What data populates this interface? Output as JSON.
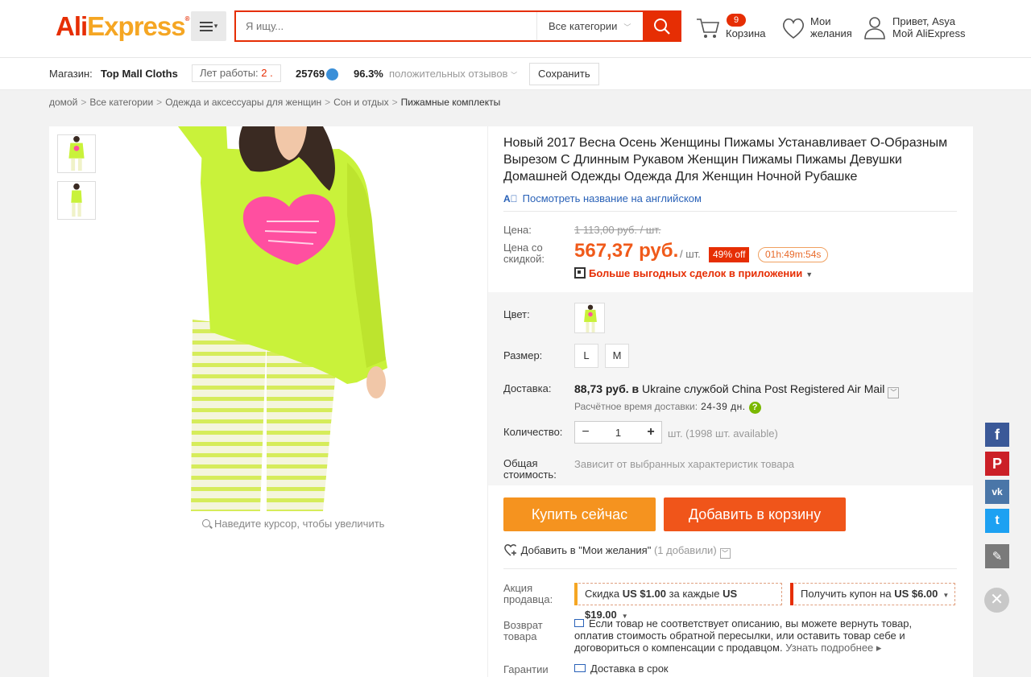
{
  "header": {
    "logo_part1": "Ali",
    "logo_part2": "Express",
    "logo_tm": "®",
    "search_placeholder": "Я ищу...",
    "category": "Все категории",
    "cart_count": "9",
    "cart_label": "Корзина",
    "wishlist_line1": "Мои",
    "wishlist_line2": "желания",
    "account_line1": "Привет, Asya",
    "account_line2": "Мой AliExpress"
  },
  "store": {
    "label": "Магазин:",
    "name": "Top Mall Cloths",
    "years_label": "Лет работы:",
    "years_value": "2 .",
    "score": "25769",
    "positive_pct": "96.3%",
    "positive_label": "положительных отзывов",
    "save_label": "Сохранить"
  },
  "breadcrumb": {
    "items": [
      "домой",
      "Все категории",
      "Одежда и аксессуары для женщин",
      "Сон и отдых"
    ],
    "current": "Пижамные комплекты",
    "separator": ">"
  },
  "gallery": {
    "zoom_hint": "Наведите курсор, чтобы увеличить"
  },
  "product": {
    "title": "Новый 2017 Весна Осень Женщины Пижамы Устанавливает О-Образным Вырезом С Длинным Рукавом Женщин Пижамы Пижамы Девушки Домашней Одежды Одежда Для Женщин Ночной Рубашке",
    "english_link": "Посмотреть название на английском",
    "price_label": "Цена:",
    "old_price": "1 113,00 руб. / шт.",
    "discount_label_1": "Цена со",
    "discount_label_2": "скидкой:",
    "new_price": "567,37 руб.",
    "unit": "/ шт.",
    "discount_badge": "49% off",
    "timer": "01h:49m:54s",
    "app_deal": "Больше выгодных сделок в приложении"
  },
  "options": {
    "color_label": "Цвет:",
    "size_label": "Размер:",
    "sizes": [
      "L",
      "M"
    ],
    "shipping_label": "Доставка:",
    "shipping_price": "88,73 руб.",
    "shipping_in": "в",
    "shipping_text": "Ukraine службой China Post Registered Air Mail",
    "eta_label": "Расчётное время доставки:",
    "eta_value": "24-39 дн.",
    "quantity_label": "Количество:",
    "quantity_value": "1",
    "quantity_minus": "−",
    "quantity_plus": "+",
    "quantity_info": "шт. (1998 шт. available)",
    "total_label_1": "Общая",
    "total_label_2": "стоимость:",
    "total_text": "Зависит от выбранных характеристик товара"
  },
  "actions": {
    "buy_now": "Купить сейчас",
    "add_to_cart": "Добавить в корзину",
    "add_wishlist": "Добавить в \"Мои желания\"",
    "wishlist_count": "(1 добавили)"
  },
  "promo": {
    "label_1": "Акция",
    "label_2": "продавца:",
    "discount_1": "Скидка",
    "discount_amount": "US $1.00",
    "discount_2": "за каждые",
    "discount_threshold": "US $19.00",
    "coupon_text": "Получить купон на",
    "coupon_amount": "US $6.00"
  },
  "returns": {
    "label_1": "Возврат",
    "label_2": "товара",
    "text": "Если товар не соответствует описанию, вы можете вернуть товар, оплатив стоимость обратной пересылки, или оставить товар себе и договориться о компенсации с продавцом.",
    "more": "Узнать подробнее"
  },
  "guarantee": {
    "label": "Гарантии",
    "text": "Доставка в срок"
  },
  "colors": {
    "accent": "#e62e04",
    "price": "#f05a1a",
    "buy": "#f5931f",
    "cart": "#f0551a",
    "link": "#2a62b8",
    "product_green": "#c9f23a",
    "heart_pink": "#ff4fa0"
  },
  "social": {
    "facebook": "f",
    "pinterest": "P",
    "vk": "vk",
    "twitter": "t",
    "edit": "✎",
    "close": "✕"
  }
}
